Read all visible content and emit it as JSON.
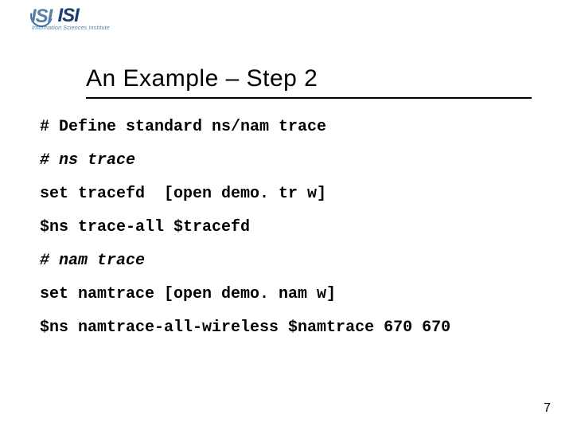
{
  "logo": {
    "acronym": "ISI",
    "full_name": "Information Sciences Institute"
  },
  "slide": {
    "title": "An Example – Step 2",
    "page_number": "7"
  },
  "code": {
    "l1": "# Define standard ns/nam trace",
    "l2": "# ns trace",
    "l3": "set tracefd  [open demo. tr w]",
    "l4": "$ns trace-all $tracefd",
    "l5": "# nam trace",
    "l6": "set namtrace [open demo. nam w]",
    "l7": "$ns namtrace-all-wireless $namtrace 670 670"
  }
}
